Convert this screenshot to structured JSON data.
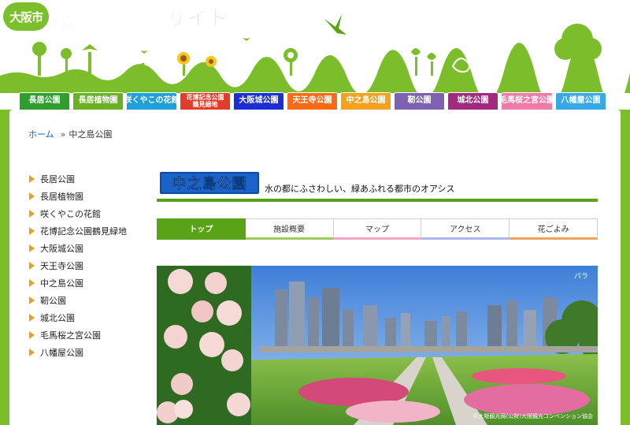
{
  "header": {
    "city": "大阪市",
    "title_parts": [
      "花",
      "と",
      "緑",
      "の",
      "情報サイト"
    ]
  },
  "nav": {
    "tabs": [
      {
        "label": "長居公園",
        "color": "#2f9e2c"
      },
      {
        "label": "長居植物園",
        "color": "#6ab023"
      },
      {
        "label": "咲くやこの花館",
        "color": "#1ea0d8"
      },
      {
        "label": "花博記念公園\n鶴見緑地",
        "color": "#e23c2c",
        "small": true
      },
      {
        "label": "大阪城公園",
        "color": "#1c2fd6"
      },
      {
        "label": "天王寺公園",
        "color": "#ff6a13"
      },
      {
        "label": "中之島公園",
        "color": "#f6a21c"
      },
      {
        "label": "靭公園",
        "color": "#7d62b3"
      },
      {
        "label": "城北公園",
        "color": "#a12a7f"
      },
      {
        "label": "毛馬桜之宮公園",
        "color": "#f27aa8"
      },
      {
        "label": "八幡屋公園",
        "color": "#38a8e8"
      }
    ]
  },
  "breadcrumb": {
    "home": "ホーム",
    "sep": "»",
    "current": "中之島公園"
  },
  "sidebar": {
    "items": [
      {
        "label": "長居公園"
      },
      {
        "label": "長居植物園"
      },
      {
        "label": "咲くやこの花館"
      },
      {
        "label": "花博記念公園鶴見緑地"
      },
      {
        "label": "大阪城公園"
      },
      {
        "label": "天王寺公園"
      },
      {
        "label": "中之島公園"
      },
      {
        "label": "靭公園"
      },
      {
        "label": "城北公園"
      },
      {
        "label": "毛馬桜之宮公園"
      },
      {
        "label": "八幡屋公園"
      }
    ]
  },
  "main": {
    "title": "中之島公園",
    "subtitle": "水の都にふさわしい、緑あふれる都市のオアシス",
    "tabs": [
      {
        "label": "トップ",
        "underline": "#5aa318",
        "active": true
      },
      {
        "label": "施設概要",
        "underline": "#9ccb5e"
      },
      {
        "label": "マップ",
        "underline": "#f3a6c8"
      },
      {
        "label": "アクセス",
        "underline": "#a9b8e8"
      },
      {
        "label": "花ごよみ",
        "underline": "#f2a35a"
      }
    ],
    "photo": {
      "label": "バラ",
      "credit": "©大阪観光局(公財)大阪観光コンベンション協会"
    }
  }
}
